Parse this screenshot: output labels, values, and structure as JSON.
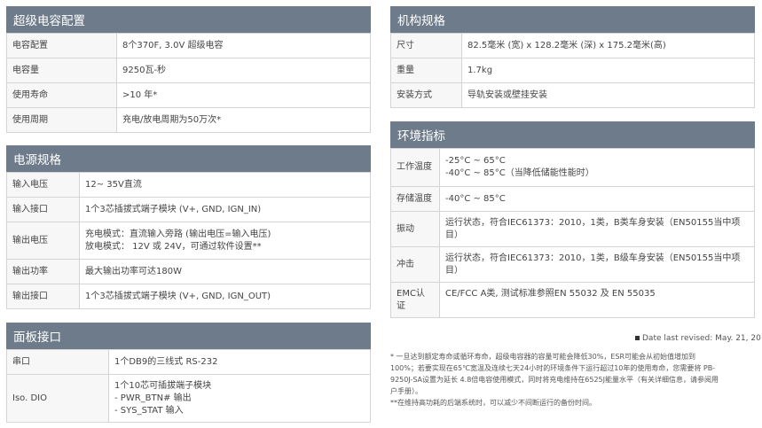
{
  "supercap": {
    "title": "超级电容配置",
    "rows": [
      {
        "k": "电容配置",
        "v": [
          "8个370F, 3.0V 超级电容"
        ]
      },
      {
        "k": "电容量",
        "v": [
          "9250瓦-秒"
        ]
      },
      {
        "k": "使用寿命",
        "v": [
          ">10 年*"
        ]
      },
      {
        "k": "使用周期",
        "v": [
          "充电/放电周期为50万次*"
        ]
      }
    ]
  },
  "power": {
    "title": "电源规格",
    "rows": [
      {
        "k": "输入电压",
        "v": [
          "12~ 35V直流"
        ]
      },
      {
        "k": "输入接口",
        "v": [
          "1个3芯插拔式端子模块 (V+, GND, IGN_IN)"
        ]
      },
      {
        "k": "输出电压",
        "v": [
          "充电模式：直流输入旁路 (输出电压=输入电压)",
          "放电模式： 12V 或 24V，可通过软件设置**"
        ]
      },
      {
        "k": "输出功率",
        "v": [
          "最大输出功率可达180W"
        ]
      },
      {
        "k": "输出接口",
        "v": [
          "1个3芯插拔式端子模块 (V+, GND, IGN_OUT)"
        ]
      }
    ]
  },
  "panel": {
    "title": "面板接口",
    "rows": [
      {
        "k": "串口",
        "v": [
          "1个DB9的三线式 RS-232"
        ]
      },
      {
        "k": "Iso. DIO",
        "v": [
          "1个10芯可插拔端子模块",
          "- PWR_BTN# 输出",
          "- SYS_STAT 输入"
        ]
      }
    ]
  },
  "mech": {
    "title": "机构规格",
    "rows": [
      {
        "k": "尺寸",
        "v": [
          "82.5毫米 (宽) x 128.2毫米 (深) x 175.2毫米(高)"
        ]
      },
      {
        "k": "重量",
        "v": [
          "1.7kg"
        ]
      },
      {
        "k": "安装方式",
        "v": [
          "导轨安装或壁挂安装"
        ]
      }
    ]
  },
  "env": {
    "title": "环境指标",
    "rows": [
      {
        "k": "工作温度",
        "v": [
          "-25°C ~ 65°C",
          "-40°C ~ 85°C（当降低储能性能时）"
        ]
      },
      {
        "k": "存储温度",
        "v": [
          "-40°C ~ 85°C"
        ]
      },
      {
        "k": "振动",
        "v": [
          "运行状态，符合IEC61373：2010，1类，B类车身安装（EN50155当中项",
          "目）"
        ]
      },
      {
        "k": "冲击",
        "v": [
          "运行状态，符合IEC61373：2010，1类，B级车身安装（EN50155当中项",
          "目）"
        ]
      },
      {
        "k": [
          "EMC认",
          "证"
        ],
        "v": [
          "CE/FCC A类, 测试标准参照EN 55032 及 EN 55035"
        ]
      }
    ]
  },
  "revised": "Date last revised: May. 21, 2019",
  "notes": [
    "* 一旦达到额定寿命或循环寿命，超级电容器的容量可能会降低30%，ESR可能会从初始值增加到",
    "100%；若要实现在65℃宽温及连续七天24小时的环境条件下运行超过10年的使用寿命，您需要将 PB-",
    "9250J-SA设置为延长 4.8倍电容使用模式，同时将充电维持在6525J能量水平（有关详细信息，请参阅用",
    "户手册）。",
    "**在维持高功耗的后端系统时，可以减少不间断运行的备份时间。"
  ]
}
